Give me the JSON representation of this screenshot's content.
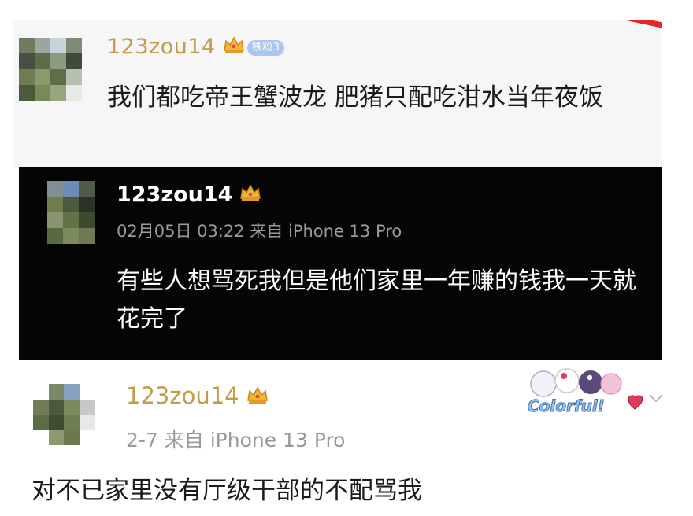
{
  "comments": [
    {
      "username": "123zou14",
      "fan_badge": "铁粉3",
      "text": "我们都吃帝王蟹波龙 肥猪只配吃泔水当年夜饭",
      "theme": "light"
    },
    {
      "username": "123zou14",
      "meta": "02月05日 03:22 来自 iPhone 13 Pro",
      "text": "有些人想骂死我但是他们家里一年赚的钱我一天就花完了",
      "theme": "dark"
    },
    {
      "username": "123zou14",
      "meta": "2-7  来自 iPhone 13 Pro",
      "text": "对不已家里没有厅级干部的不配骂我",
      "sticker_text": "Colorful!",
      "theme": "white"
    }
  ],
  "colors": {
    "username_gold": "#c39b4a",
    "badge_blue": "#a9c6ee",
    "accent_red": "#e6232b",
    "dark_bg": "#050505"
  },
  "icons": [
    "crown-icon",
    "chevron-down-icon",
    "heart-icon"
  ]
}
